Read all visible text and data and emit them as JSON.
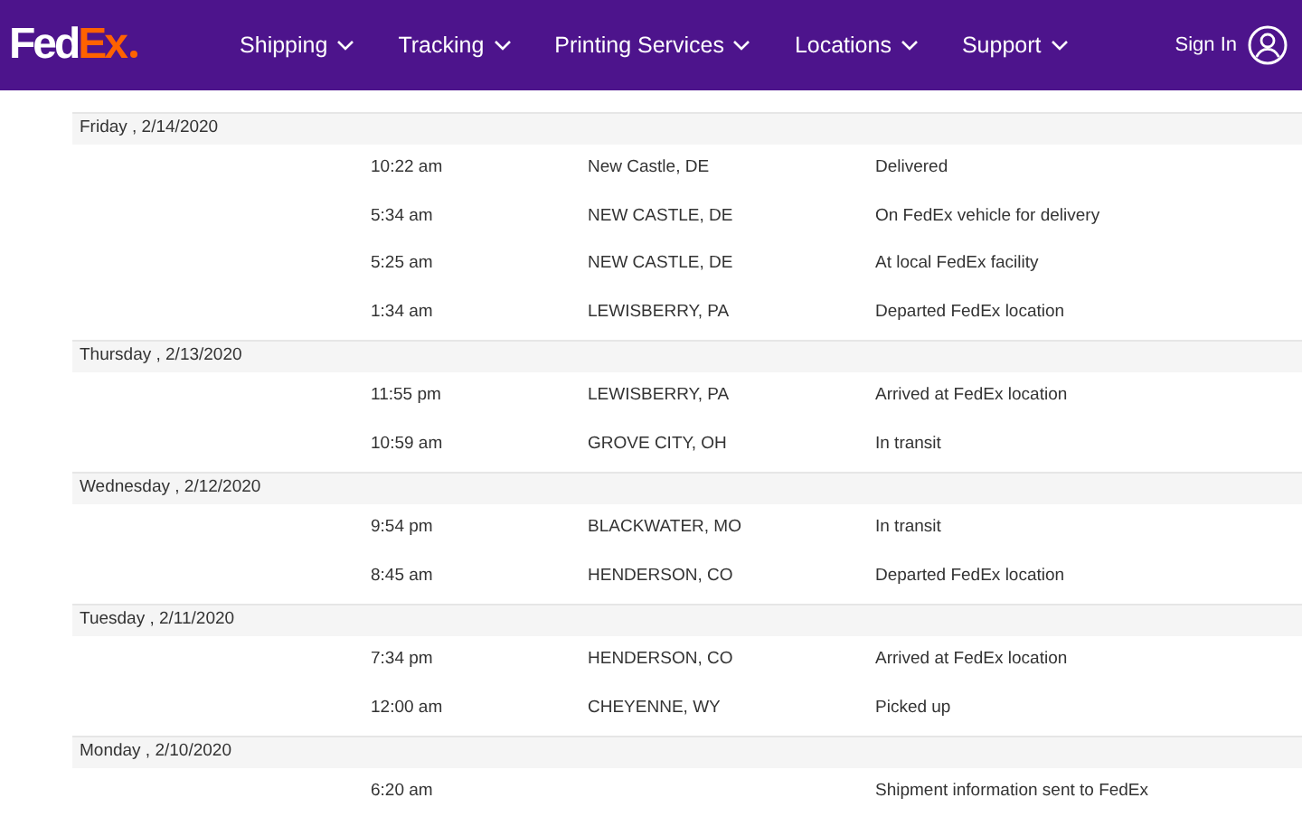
{
  "header": {
    "logo": {
      "part_1": "Fed",
      "part_2": "Ex"
    },
    "nav": [
      {
        "label": "Shipping"
      },
      {
        "label": "Tracking"
      },
      {
        "label": "Printing Services"
      },
      {
        "label": "Locations"
      },
      {
        "label": "Support"
      }
    ],
    "sign_in": "Sign In"
  },
  "days": [
    {
      "date": "Friday , 2/14/2020",
      "events": [
        {
          "time": "10:22 am",
          "location": "New Castle, DE",
          "status": "Delivered"
        },
        {
          "time": "5:34 am",
          "location": "NEW CASTLE, DE",
          "status": "On FedEx vehicle for delivery"
        },
        {
          "time": "5:25 am",
          "location": "NEW CASTLE, DE",
          "status": "At local FedEx facility"
        },
        {
          "time": "1:34 am",
          "location": "LEWISBERRY, PA",
          "status": "Departed FedEx location"
        }
      ]
    },
    {
      "date": "Thursday , 2/13/2020",
      "events": [
        {
          "time": "11:55 pm",
          "location": "LEWISBERRY, PA",
          "status": "Arrived at FedEx location"
        },
        {
          "time": "10:59 am",
          "location": "GROVE CITY, OH",
          "status": "In transit"
        }
      ]
    },
    {
      "date": "Wednesday , 2/12/2020",
      "events": [
        {
          "time": "9:54 pm",
          "location": "BLACKWATER, MO",
          "status": "In transit"
        },
        {
          "time": "8:45 am",
          "location": "HENDERSON, CO",
          "status": "Departed FedEx location"
        }
      ]
    },
    {
      "date": "Tuesday , 2/11/2020",
      "events": [
        {
          "time": "7:34 pm",
          "location": "HENDERSON, CO",
          "status": "Arrived at FedEx location"
        },
        {
          "time": "12:00 am",
          "location": "CHEYENNE, WY",
          "status": "Picked up"
        }
      ]
    },
    {
      "date": "Monday , 2/10/2020",
      "events": [
        {
          "time": "6:20 am",
          "status": "Shipment information sent to FedEx"
        }
      ]
    }
  ]
}
